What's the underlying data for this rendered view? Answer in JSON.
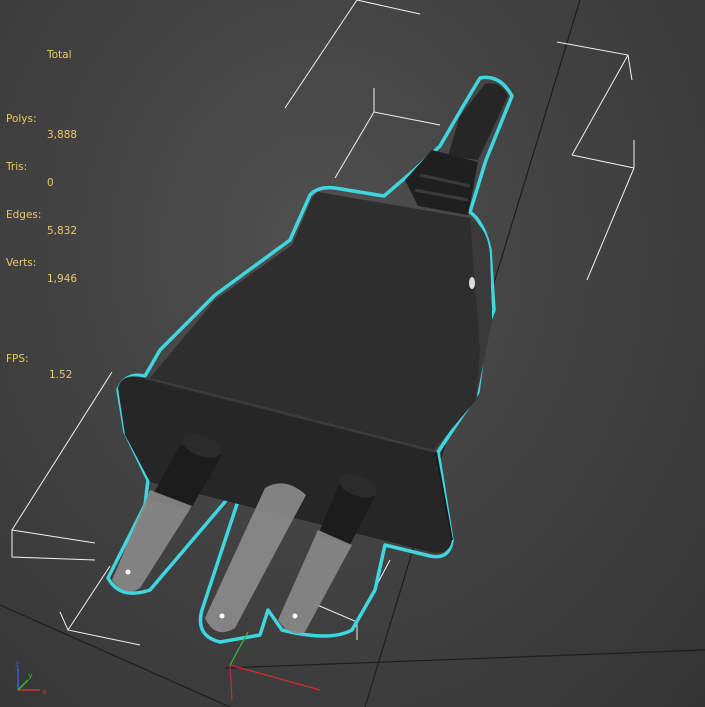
{
  "stats": {
    "header": "Total",
    "rows": [
      {
        "label": "Polys:",
        "value": "3,888"
      },
      {
        "label": "Tris:",
        "value": "0"
      },
      {
        "label": "Edges:",
        "value": "5,832"
      },
      {
        "label": "Verts:",
        "value": "1,946"
      }
    ],
    "fps_label": "FPS:",
    "fps_value": "1.52"
  },
  "colors": {
    "stats_text": "#e8c86a",
    "selection_outline": "#3fd6e0",
    "model_body": "#2e2e2e",
    "pins": "#8a8a8a",
    "gizmo_box": "#ffffff",
    "axis_x": "#d03030",
    "axis_y": "#30c030",
    "axis_z": "#3060e0"
  },
  "icons": {
    "axis_tripod": "xyz-axis-icon"
  }
}
